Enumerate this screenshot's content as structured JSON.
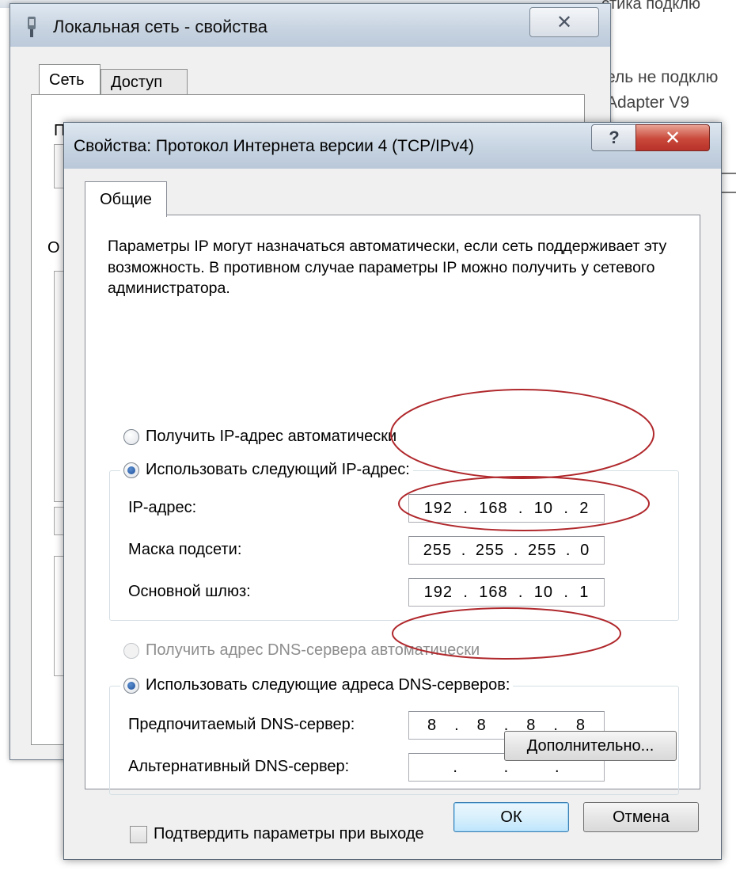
{
  "background": {
    "line1": "ель не подклю",
    "line2": "Adapter V9",
    "topright": "стика подклю"
  },
  "lan_window": {
    "title": "Локальная сеть - свойства",
    "close_glyph": "✕",
    "tabs": [
      "Сеть",
      "Доступ"
    ],
    "fragment_p": "П",
    "fragment_o": "О"
  },
  "dialog": {
    "title": "Свойства: Протокол Интернета версии 4 (TCP/IPv4)",
    "help_glyph": "?",
    "close_glyph": "✕",
    "tab": "Общие",
    "description": "Параметры IP могут назначаться автоматически, если сеть поддерживает эту возможность. В противном случае параметры IP можно получить у сетевого администратора.",
    "ip_auto": "Получить IP-адрес автоматически",
    "ip_manual": "Использовать следующий IP-адрес:",
    "ip_label": "IP-адрес:",
    "mask_label": "Маска подсети:",
    "gateway_label": "Основной шлюз:",
    "ip": [
      "192",
      "168",
      "10",
      "2"
    ],
    "mask": [
      "255",
      "255",
      "255",
      "0"
    ],
    "gateway": [
      "192",
      "168",
      "10",
      "1"
    ],
    "dns_auto": "Получить адрес DNS-сервера автоматически",
    "dns_manual": "Использовать следующие адреса DNS-серверов:",
    "dns_pref_label": "Предпочитаемый DNS-сервер:",
    "dns_alt_label": "Альтернативный DNS-сервер:",
    "dns_pref": [
      "8",
      "8",
      "8",
      "8"
    ],
    "dns_alt": [
      "",
      "",
      "",
      ""
    ],
    "confirm_checkbox": "Подтвердить параметры при выходе",
    "advanced_button": "Дополнительно...",
    "ok_button": "ОК",
    "cancel_button": "Отмена"
  },
  "colors": {
    "annotation_ellipse": "#b0282c",
    "close_button": "#c9483a"
  }
}
